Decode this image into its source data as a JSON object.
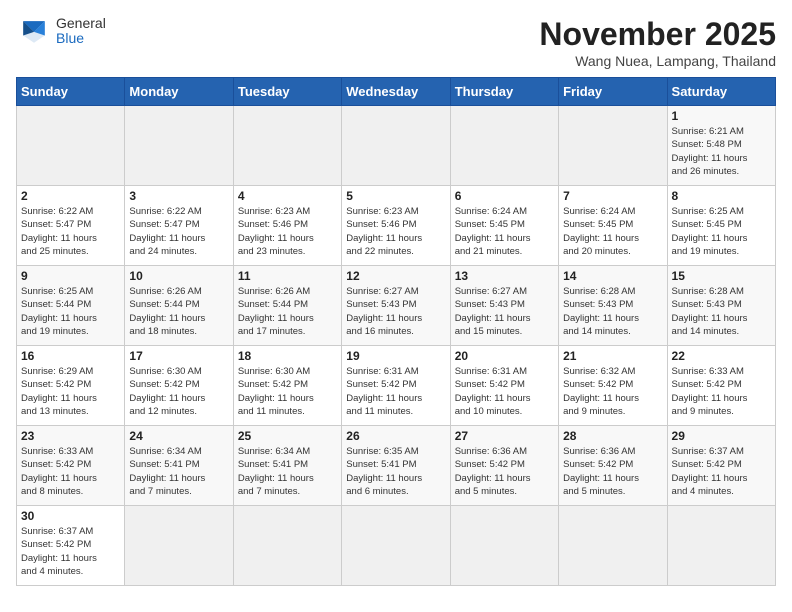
{
  "header": {
    "logo_general": "General",
    "logo_blue": "Blue",
    "month_year": "November 2025",
    "location": "Wang Nuea, Lampang, Thailand"
  },
  "days_of_week": [
    "Sunday",
    "Monday",
    "Tuesday",
    "Wednesday",
    "Thursday",
    "Friday",
    "Saturday"
  ],
  "weeks": [
    [
      {
        "day": "",
        "info": ""
      },
      {
        "day": "",
        "info": ""
      },
      {
        "day": "",
        "info": ""
      },
      {
        "day": "",
        "info": ""
      },
      {
        "day": "",
        "info": ""
      },
      {
        "day": "",
        "info": ""
      },
      {
        "day": "1",
        "info": "Sunrise: 6:21 AM\nSunset: 5:48 PM\nDaylight: 11 hours\nand 26 minutes."
      }
    ],
    [
      {
        "day": "2",
        "info": "Sunrise: 6:22 AM\nSunset: 5:47 PM\nDaylight: 11 hours\nand 25 minutes."
      },
      {
        "day": "3",
        "info": "Sunrise: 6:22 AM\nSunset: 5:47 PM\nDaylight: 11 hours\nand 24 minutes."
      },
      {
        "day": "4",
        "info": "Sunrise: 6:23 AM\nSunset: 5:46 PM\nDaylight: 11 hours\nand 23 minutes."
      },
      {
        "day": "5",
        "info": "Sunrise: 6:23 AM\nSunset: 5:46 PM\nDaylight: 11 hours\nand 22 minutes."
      },
      {
        "day": "6",
        "info": "Sunrise: 6:24 AM\nSunset: 5:45 PM\nDaylight: 11 hours\nand 21 minutes."
      },
      {
        "day": "7",
        "info": "Sunrise: 6:24 AM\nSunset: 5:45 PM\nDaylight: 11 hours\nand 20 minutes."
      },
      {
        "day": "8",
        "info": "Sunrise: 6:25 AM\nSunset: 5:45 PM\nDaylight: 11 hours\nand 19 minutes."
      }
    ],
    [
      {
        "day": "9",
        "info": "Sunrise: 6:25 AM\nSunset: 5:44 PM\nDaylight: 11 hours\nand 19 minutes."
      },
      {
        "day": "10",
        "info": "Sunrise: 6:26 AM\nSunset: 5:44 PM\nDaylight: 11 hours\nand 18 minutes."
      },
      {
        "day": "11",
        "info": "Sunrise: 6:26 AM\nSunset: 5:44 PM\nDaylight: 11 hours\nand 17 minutes."
      },
      {
        "day": "12",
        "info": "Sunrise: 6:27 AM\nSunset: 5:43 PM\nDaylight: 11 hours\nand 16 minutes."
      },
      {
        "day": "13",
        "info": "Sunrise: 6:27 AM\nSunset: 5:43 PM\nDaylight: 11 hours\nand 15 minutes."
      },
      {
        "day": "14",
        "info": "Sunrise: 6:28 AM\nSunset: 5:43 PM\nDaylight: 11 hours\nand 14 minutes."
      },
      {
        "day": "15",
        "info": "Sunrise: 6:28 AM\nSunset: 5:43 PM\nDaylight: 11 hours\nand 14 minutes."
      }
    ],
    [
      {
        "day": "16",
        "info": "Sunrise: 6:29 AM\nSunset: 5:42 PM\nDaylight: 11 hours\nand 13 minutes."
      },
      {
        "day": "17",
        "info": "Sunrise: 6:30 AM\nSunset: 5:42 PM\nDaylight: 11 hours\nand 12 minutes."
      },
      {
        "day": "18",
        "info": "Sunrise: 6:30 AM\nSunset: 5:42 PM\nDaylight: 11 hours\nand 11 minutes."
      },
      {
        "day": "19",
        "info": "Sunrise: 6:31 AM\nSunset: 5:42 PM\nDaylight: 11 hours\nand 11 minutes."
      },
      {
        "day": "20",
        "info": "Sunrise: 6:31 AM\nSunset: 5:42 PM\nDaylight: 11 hours\nand 10 minutes."
      },
      {
        "day": "21",
        "info": "Sunrise: 6:32 AM\nSunset: 5:42 PM\nDaylight: 11 hours\nand 9 minutes."
      },
      {
        "day": "22",
        "info": "Sunrise: 6:33 AM\nSunset: 5:42 PM\nDaylight: 11 hours\nand 9 minutes."
      }
    ],
    [
      {
        "day": "23",
        "info": "Sunrise: 6:33 AM\nSunset: 5:42 PM\nDaylight: 11 hours\nand 8 minutes."
      },
      {
        "day": "24",
        "info": "Sunrise: 6:34 AM\nSunset: 5:41 PM\nDaylight: 11 hours\nand 7 minutes."
      },
      {
        "day": "25",
        "info": "Sunrise: 6:34 AM\nSunset: 5:41 PM\nDaylight: 11 hours\nand 7 minutes."
      },
      {
        "day": "26",
        "info": "Sunrise: 6:35 AM\nSunset: 5:41 PM\nDaylight: 11 hours\nand 6 minutes."
      },
      {
        "day": "27",
        "info": "Sunrise: 6:36 AM\nSunset: 5:42 PM\nDaylight: 11 hours\nand 5 minutes."
      },
      {
        "day": "28",
        "info": "Sunrise: 6:36 AM\nSunset: 5:42 PM\nDaylight: 11 hours\nand 5 minutes."
      },
      {
        "day": "29",
        "info": "Sunrise: 6:37 AM\nSunset: 5:42 PM\nDaylight: 11 hours\nand 4 minutes."
      }
    ],
    [
      {
        "day": "30",
        "info": "Sunrise: 6:37 AM\nSunset: 5:42 PM\nDaylight: 11 hours\nand 4 minutes."
      },
      {
        "day": "",
        "info": ""
      },
      {
        "day": "",
        "info": ""
      },
      {
        "day": "",
        "info": ""
      },
      {
        "day": "",
        "info": ""
      },
      {
        "day": "",
        "info": ""
      },
      {
        "day": "",
        "info": ""
      }
    ]
  ]
}
